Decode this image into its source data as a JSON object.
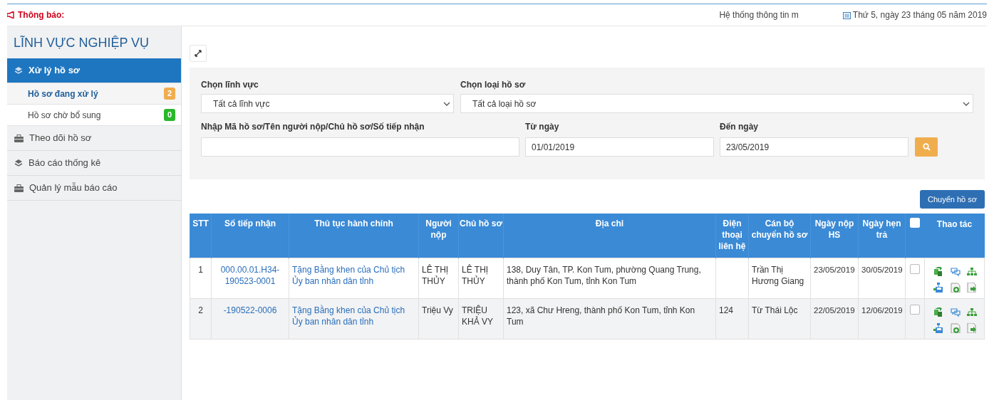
{
  "topbar": {
    "notice_label": "Thông báo:",
    "marquee": "Hệ thống thông tin m",
    "date": "Thứ 5, ngày 23 tháng 05 năm 2019"
  },
  "sidebar": {
    "title": "LĨNH VỰC NGHIỆP VỤ",
    "items": [
      {
        "label": "Xử lý hồ sơ",
        "kind": "layers",
        "selected": true,
        "children": [
          {
            "label": "Hồ sơ đang xử lý",
            "badge": "2",
            "color": "#f0ad4e",
            "selected": true
          },
          {
            "label": "Hồ sơ chờ bổ sung",
            "badge": "0",
            "color": "#2bb72b",
            "selected": false
          }
        ]
      },
      {
        "label": "Theo dõi hồ sơ",
        "kind": "case",
        "selected": false
      },
      {
        "label": "Báo cáo thống kê",
        "kind": "layers",
        "selected": false
      },
      {
        "label": "Quản lý mẫu báo cáo",
        "kind": "case",
        "selected": false
      }
    ]
  },
  "filters": {
    "field_label": "Chọn lĩnh vực",
    "field_value": "Tất cả lĩnh vực",
    "type_label": "Chọn loại hồ sơ",
    "type_value": "Tất cả loại hồ sơ",
    "keyword_label": "Nhập Mã hồ sơ/Tên người nộp/Chủ hồ sơ/Số tiếp nhận",
    "from_label": "Từ ngày",
    "from_value": "01/01/2019",
    "to_label": "Đến ngày",
    "to_value": "23/05/2019"
  },
  "transfer_button": "Chuyển hồ sơ",
  "table": {
    "columns": [
      "STT",
      "Số tiếp nhận",
      "Thủ tục hành chính",
      "Người nộp",
      "Chủ hồ sơ",
      "Địa chỉ",
      "Điện thoại liên hệ",
      "Cán bộ chuyển hồ sơ",
      "Ngày nộp HS",
      "Ngày hẹn trả",
      "Thao tác"
    ],
    "all_checked": false,
    "rows": [
      {
        "stt": "1",
        "receipt": "000.00.01.H34-190523-0001",
        "procedure": "Tặng Bằng khen của Chủ tịch Ủy ban nhân dân tỉnh",
        "submitter": "LÊ THỊ THỦY",
        "owner": "LÊ THỊ THỦY",
        "address": "138, Duy Tân, TP. Kon Tum, phường Quang Trung, thành phố Kon Tum, tỉnh Kon Tum",
        "phone": "",
        "officer": "Trần Thị Hương Giang",
        "submitted": "23/05/2019",
        "due": "30/05/2019",
        "checked": false
      },
      {
        "stt": "2",
        "receipt": "-190522-0006",
        "procedure": "Tặng Bằng khen của Chủ tịch Ủy ban nhân dân tỉnh",
        "submitter": "Triệu Vy",
        "owner": "TRIỆU KHẢ VY",
        "address": "123, xã Chư Hreng, thành phố Kon Tum, tỉnh Kon Tum",
        "phone": "124",
        "officer": "Từ Thái Lộc",
        "submitted": "22/05/2019",
        "due": "12/06/2019",
        "checked": false
      }
    ]
  }
}
